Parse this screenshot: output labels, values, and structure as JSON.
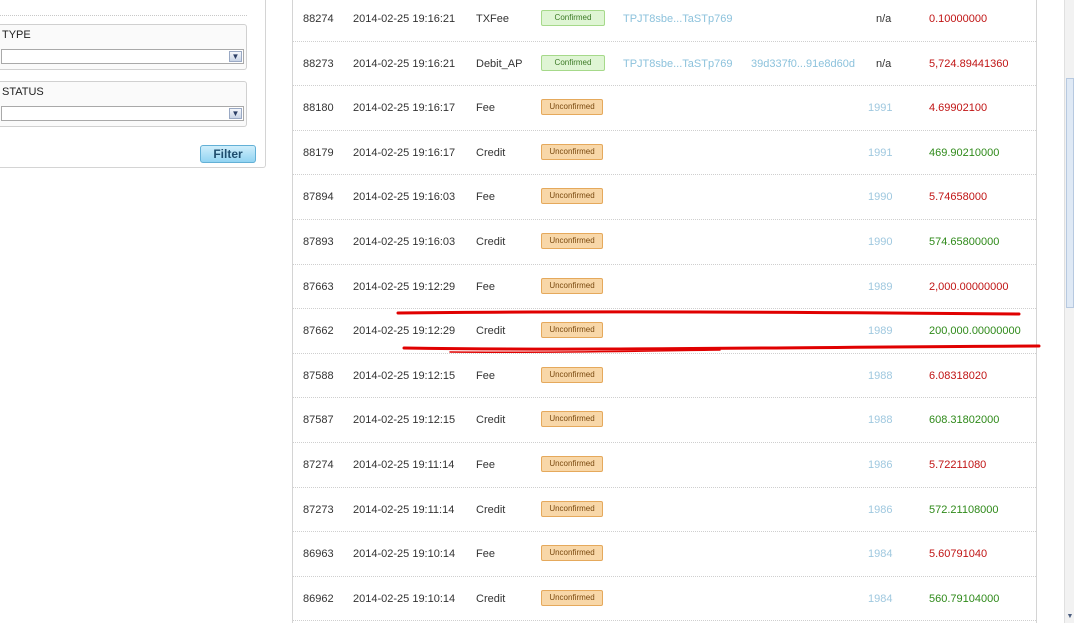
{
  "filters": {
    "type_label": "TYPE",
    "type_value": "",
    "status_label": "STATUS",
    "status_value": "",
    "filter_button": "Filter",
    "arrow_icon": "chevron-down-icon"
  },
  "transactions": [
    {
      "id": "88274",
      "date": "2014-02-25 19:16:21",
      "type": "TXFee",
      "status": "Confirmed",
      "address": "TPJT8sbe...TaSTp769",
      "hash": "",
      "confirmations": "n/a",
      "amount": "0.10000000",
      "amount_color": "red"
    },
    {
      "id": "88273",
      "date": "2014-02-25 19:16:21",
      "type": "Debit_AP",
      "status": "Confirmed",
      "address": "TPJT8sbe...TaSTp769",
      "hash": "39d337f0...91e8d60d",
      "confirmations": "n/a",
      "amount": "5,724.89441360",
      "amount_color": "red"
    },
    {
      "id": "88180",
      "date": "2014-02-25 19:16:17",
      "type": "Fee",
      "status": "Unconfirmed",
      "address": "",
      "hash": "",
      "confirmations": "1991",
      "amount": "4.69902100",
      "amount_color": "red"
    },
    {
      "id": "88179",
      "date": "2014-02-25 19:16:17",
      "type": "Credit",
      "status": "Unconfirmed",
      "address": "",
      "hash": "",
      "confirmations": "1991",
      "amount": "469.90210000",
      "amount_color": "green"
    },
    {
      "id": "87894",
      "date": "2014-02-25 19:16:03",
      "type": "Fee",
      "status": "Unconfirmed",
      "address": "",
      "hash": "",
      "confirmations": "1990",
      "amount": "5.74658000",
      "amount_color": "red"
    },
    {
      "id": "87893",
      "date": "2014-02-25 19:16:03",
      "type": "Credit",
      "status": "Unconfirmed",
      "address": "",
      "hash": "",
      "confirmations": "1990",
      "amount": "574.65800000",
      "amount_color": "green"
    },
    {
      "id": "87663",
      "date": "2014-02-25 19:12:29",
      "type": "Fee",
      "status": "Unconfirmed",
      "address": "",
      "hash": "",
      "confirmations": "1989",
      "amount": "2,000.00000000",
      "amount_color": "red"
    },
    {
      "id": "87662",
      "date": "2014-02-25 19:12:29",
      "type": "Credit",
      "status": "Unconfirmed",
      "address": "",
      "hash": "",
      "confirmations": "1989",
      "amount": "200,000.00000000",
      "amount_color": "green"
    },
    {
      "id": "87588",
      "date": "2014-02-25 19:12:15",
      "type": "Fee",
      "status": "Unconfirmed",
      "address": "",
      "hash": "",
      "confirmations": "1988",
      "amount": "6.08318020",
      "amount_color": "red"
    },
    {
      "id": "87587",
      "date": "2014-02-25 19:12:15",
      "type": "Credit",
      "status": "Unconfirmed",
      "address": "",
      "hash": "",
      "confirmations": "1988",
      "amount": "608.31802000",
      "amount_color": "green"
    },
    {
      "id": "87274",
      "date": "2014-02-25 19:11:14",
      "type": "Fee",
      "status": "Unconfirmed",
      "address": "",
      "hash": "",
      "confirmations": "1986",
      "amount": "5.72211080",
      "amount_color": "red"
    },
    {
      "id": "87273",
      "date": "2014-02-25 19:11:14",
      "type": "Credit",
      "status": "Unconfirmed",
      "address": "",
      "hash": "",
      "confirmations": "1986",
      "amount": "572.21108000",
      "amount_color": "green"
    },
    {
      "id": "86963",
      "date": "2014-02-25 19:10:14",
      "type": "Fee",
      "status": "Unconfirmed",
      "address": "",
      "hash": "",
      "confirmations": "1984",
      "amount": "5.60791040",
      "amount_color": "red"
    },
    {
      "id": "86962",
      "date": "2014-02-25 19:10:14",
      "type": "Credit",
      "status": "Unconfirmed",
      "address": "",
      "hash": "",
      "confirmations": "1984",
      "amount": "560.79104000",
      "amount_color": "green"
    }
  ],
  "colors": {
    "amount_red": "#c01414",
    "amount_green": "#2f8a1a",
    "link_blue": "#8cc2dc",
    "annotation_red": "#e00000"
  }
}
